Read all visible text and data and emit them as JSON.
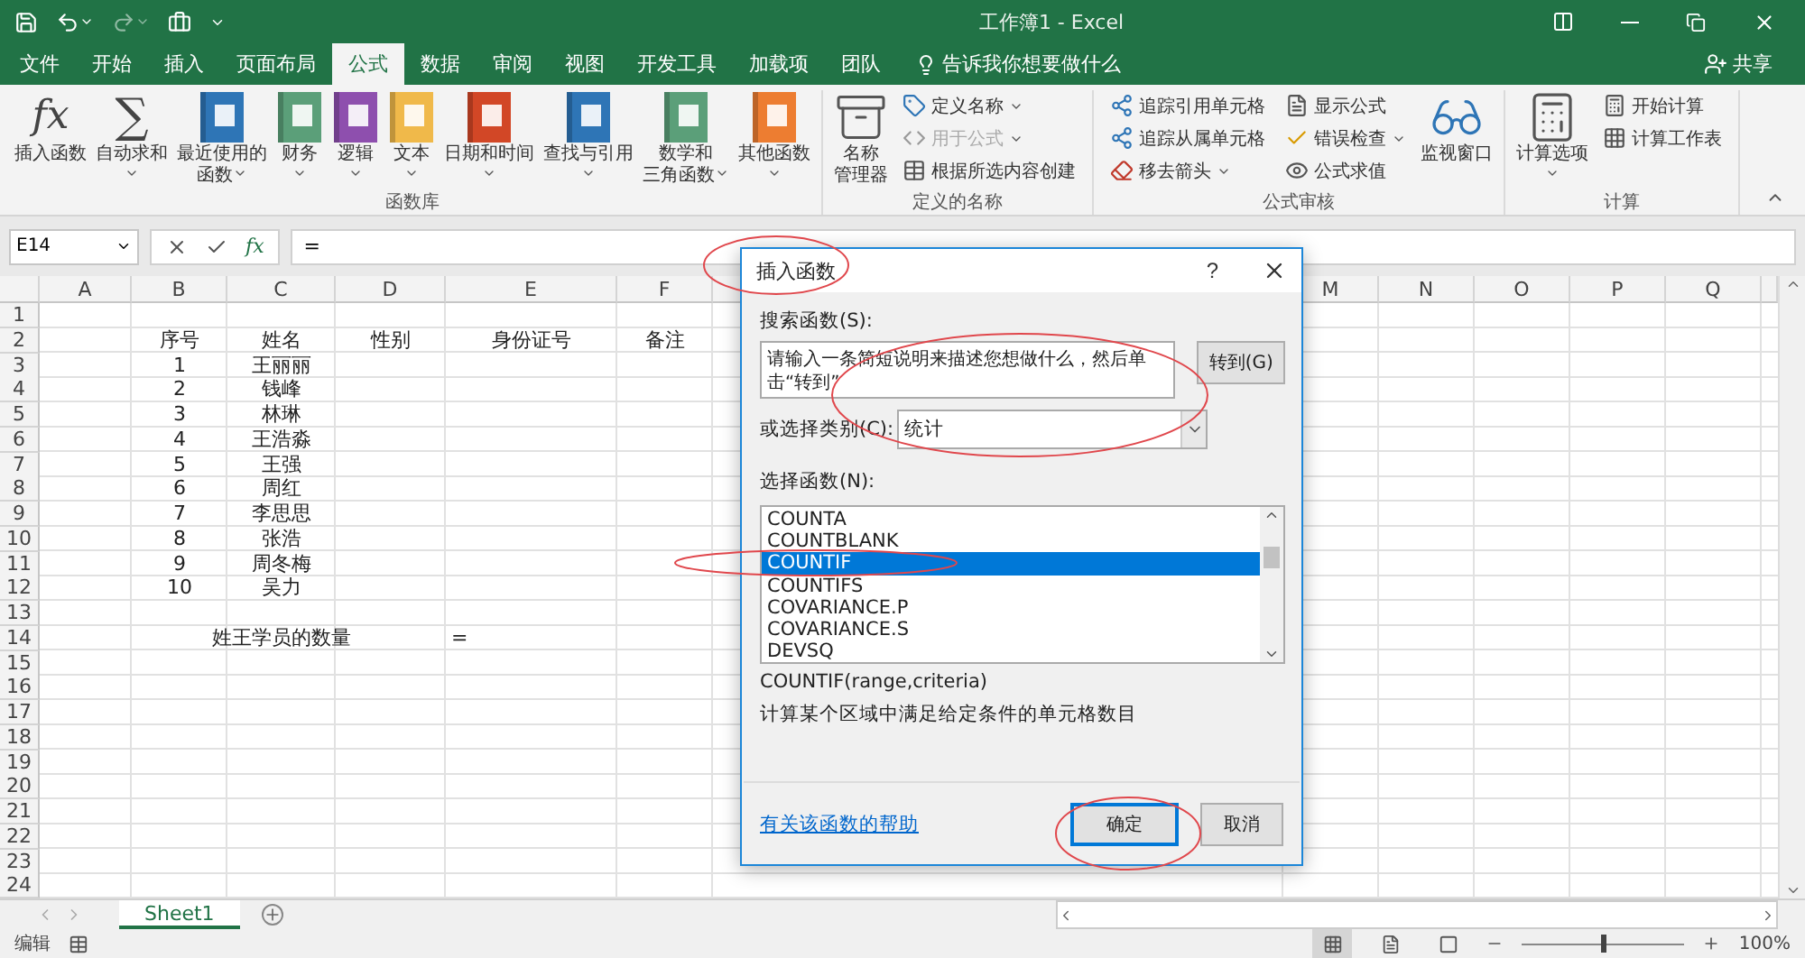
{
  "title_bar": {
    "title": "工作簿1 - Excel"
  },
  "tabs": [
    {
      "label": "文件",
      "selected": false
    },
    {
      "label": "开始",
      "selected": false
    },
    {
      "label": "插入",
      "selected": false
    },
    {
      "label": "页面布局",
      "selected": false
    },
    {
      "label": "公式",
      "selected": true
    },
    {
      "label": "数据",
      "selected": false
    },
    {
      "label": "审阅",
      "selected": false
    },
    {
      "label": "视图",
      "selected": false
    },
    {
      "label": "开发工具",
      "selected": false
    },
    {
      "label": "加载项",
      "selected": false
    },
    {
      "label": "团队",
      "selected": false
    }
  ],
  "tell_me": {
    "placeholder": "告诉我你想要做什么"
  },
  "share": "共享",
  "ribbon_groups": [
    {
      "label": "函数库",
      "columns": [
        {
          "kind": "large",
          "buttons": [
            {
              "kind": "function",
              "glyph": "fx",
              "lines": [
                "插入函数"
              ],
              "dropdown": false,
              "disabled": false
            }
          ]
        },
        {
          "kind": "large",
          "buttons": [
            {
              "kind": "sum",
              "glyph": "∑",
              "lines": [
                "自动求和"
              ],
              "dropdown": true,
              "disabled": false
            }
          ]
        },
        {
          "kind": "large",
          "buttons": [
            {
              "kind": "recent",
              "lines": [
                "最近使用的",
                "函数"
              ],
              "dropdown": true,
              "disabled": false
            }
          ]
        },
        {
          "kind": "large",
          "buttons": [
            {
              "kind": "financial",
              "lines": [
                "财务"
              ],
              "dropdown": true,
              "disabled": false
            }
          ]
        },
        {
          "kind": "large",
          "buttons": [
            {
              "kind": "logical",
              "lines": [
                "逻辑"
              ],
              "dropdown": true,
              "disabled": false
            }
          ]
        },
        {
          "kind": "large",
          "buttons": [
            {
              "kind": "text",
              "lines": [
                "文本"
              ],
              "dropdown": true,
              "disabled": false
            }
          ]
        },
        {
          "kind": "large",
          "buttons": [
            {
              "kind": "datetime",
              "lines": [
                "日期和时间"
              ],
              "dropdown": true,
              "disabled": false
            }
          ]
        },
        {
          "kind": "large",
          "buttons": [
            {
              "kind": "lookup",
              "lines": [
                "查找与引用"
              ],
              "dropdown": true,
              "disabled": false
            }
          ]
        },
        {
          "kind": "large",
          "buttons": [
            {
              "kind": "math",
              "lines": [
                "数学和",
                "三角函数"
              ],
              "dropdown": true,
              "disabled": false
            }
          ]
        },
        {
          "kind": "large",
          "buttons": [
            {
              "kind": "more",
              "lines": [
                "其他函数"
              ],
              "dropdown": true,
              "disabled": false
            }
          ]
        }
      ]
    },
    {
      "label": "定义的名称",
      "columns": [
        {
          "kind": "large",
          "buttons": [
            {
              "kind": "names",
              "lines": [
                "名称",
                "管理器"
              ],
              "dropdown": false,
              "disabled": false
            }
          ]
        },
        {
          "kind": "small",
          "buttons": [
            {
              "kind": "tag",
              "label": "定义名称",
              "dropdown": true,
              "disabled": false
            },
            {
              "kind": "formula",
              "label": "用于公式",
              "dropdown": true,
              "disabled": true
            },
            {
              "kind": "table",
              "label": "根据所选内容创建",
              "dropdown": false,
              "disabled": false
            }
          ]
        }
      ]
    },
    {
      "label": "公式审核",
      "columns": [
        {
          "kind": "small",
          "buttons": [
            {
              "kind": "precedents",
              "label": "追踪引用单元格",
              "dropdown": false,
              "disabled": false
            },
            {
              "kind": "dependents",
              "label": "追踪从属单元格",
              "dropdown": false,
              "disabled": false
            },
            {
              "kind": "remove",
              "label": "移去箭头",
              "dropdown": true,
              "disabled": false
            }
          ]
        },
        {
          "kind": "small",
          "buttons": [
            {
              "kind": "show",
              "label": "显示公式",
              "dropdown": false,
              "disabled": false
            },
            {
              "kind": "check",
              "label": "错误检查",
              "dropdown": true,
              "disabled": false
            },
            {
              "kind": "evaluate",
              "label": "公式求值",
              "dropdown": false,
              "disabled": false
            }
          ]
        },
        {
          "kind": "large",
          "buttons": [
            {
              "kind": "watch",
              "lines": [
                "监视窗口"
              ],
              "dropdown": false,
              "disabled": false
            }
          ]
        }
      ]
    },
    {
      "label": "计算",
      "columns": [
        {
          "kind": "large",
          "buttons": [
            {
              "kind": "calc",
              "lines": [
                "计算选项"
              ],
              "dropdown": true,
              "disabled": false
            }
          ]
        },
        {
          "kind": "small",
          "buttons": [
            {
              "kind": "calcnow",
              "label": "开始计算",
              "dropdown": false,
              "disabled": false
            },
            {
              "kind": "calcsheet",
              "label": "计算工作表",
              "dropdown": false,
              "disabled": false
            }
          ]
        }
      ]
    }
  ],
  "formula_bar": {
    "name_box": "E14",
    "fx": "fx",
    "value": "="
  },
  "columns": [
    "A",
    "B",
    "C",
    "D",
    "E",
    "F",
    "M",
    "N",
    "O",
    "P",
    "Q"
  ],
  "rows": [
    {
      "label": "1"
    },
    {
      "label": "2",
      "b": "序号",
      "c": "姓名",
      "d": "性别",
      "e": "身份证号",
      "f": "备注"
    },
    {
      "label": "3",
      "b": "1",
      "c": "王丽丽"
    },
    {
      "label": "4",
      "b": "2",
      "c": "钱峰"
    },
    {
      "label": "5",
      "b": "3",
      "c": "林琳"
    },
    {
      "label": "6",
      "b": "4",
      "c": "王浩淼"
    },
    {
      "label": "7",
      "b": "5",
      "c": "王强"
    },
    {
      "label": "8",
      "b": "6",
      "c": "周红"
    },
    {
      "label": "9",
      "b": "7",
      "c": "李思思"
    },
    {
      "label": "10",
      "b": "8",
      "c": "张浩"
    },
    {
      "label": "11",
      "b": "9",
      "c": "周冬梅"
    },
    {
      "label": "12",
      "b": "10",
      "c": "吴力"
    },
    {
      "label": "13"
    },
    {
      "label": "14",
      "c": "姓王学员的数量",
      "e": "="
    },
    {
      "label": "15"
    },
    {
      "label": "16"
    },
    {
      "label": "17"
    },
    {
      "label": "18"
    },
    {
      "label": "19"
    },
    {
      "label": "20"
    },
    {
      "label": "21"
    },
    {
      "label": "22"
    },
    {
      "label": "23"
    },
    {
      "label": "24"
    }
  ],
  "dialog": {
    "title": "插入函数",
    "help": "?",
    "search_label": "搜索函数(S):",
    "search": {
      "value": "请输入一条简短说明来描述您想做什么，然后单击“转到”"
    },
    "go_button": "转到(G)",
    "category_label": "或选择类别(C):",
    "category": {
      "value": "统计"
    },
    "function_label": "选择函数(N):",
    "functions": [
      {
        "name": "COUNTA",
        "selected": false
      },
      {
        "name": "COUNTBLANK",
        "selected": false
      },
      {
        "name": "COUNTIF",
        "selected": true
      },
      {
        "name": "COUNTIFS",
        "selected": false
      },
      {
        "name": "COVARIANCE.P",
        "selected": false
      },
      {
        "name": "COVARIANCE.S",
        "selected": false
      },
      {
        "name": "DEVSQ",
        "selected": false
      }
    ],
    "signature": "COUNTIF(range,criteria)",
    "description": "计算某个区域中满足给定条件的单元格数目",
    "help_link": "有关该函数的帮助",
    "ok_button": "确定",
    "cancel_button": "取消"
  },
  "sheets": [
    {
      "label": "Sheet1",
      "selected": true
    }
  ],
  "status_bar": {
    "mode": "编辑",
    "views": [
      {
        "kind": "normal",
        "selected": true
      },
      {
        "kind": "layout",
        "selected": false
      },
      {
        "kind": "pagebreak",
        "selected": false
      }
    ],
    "zoom": {
      "level": 0.5,
      "reading": "100%"
    }
  }
}
